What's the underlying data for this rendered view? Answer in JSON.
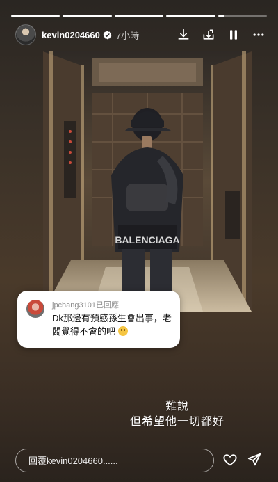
{
  "progress": {
    "segments": 5,
    "active_index": 4,
    "active_fill_percent": 12
  },
  "header": {
    "username": "kevin0204660",
    "verified": true,
    "time": "7小時",
    "icons": [
      "download-icon",
      "share-to-icon",
      "pause-icon",
      "more-icon"
    ]
  },
  "comment": {
    "username_line": "jpchang3101已回應",
    "text": "Dk那邊有預感孫生會出事，老闆覺得不會的吧",
    "emoji": "confounded-face-emoji"
  },
  "overlay": {
    "line1": "難說",
    "line2": "但希望他一切都好"
  },
  "reply": {
    "placeholder": "回覆kevin0204660......"
  },
  "actions": [
    "heart-icon",
    "send-icon"
  ],
  "colors": {
    "background": "#3a2e24",
    "text": "#ffffff",
    "card": "#ffffff"
  }
}
